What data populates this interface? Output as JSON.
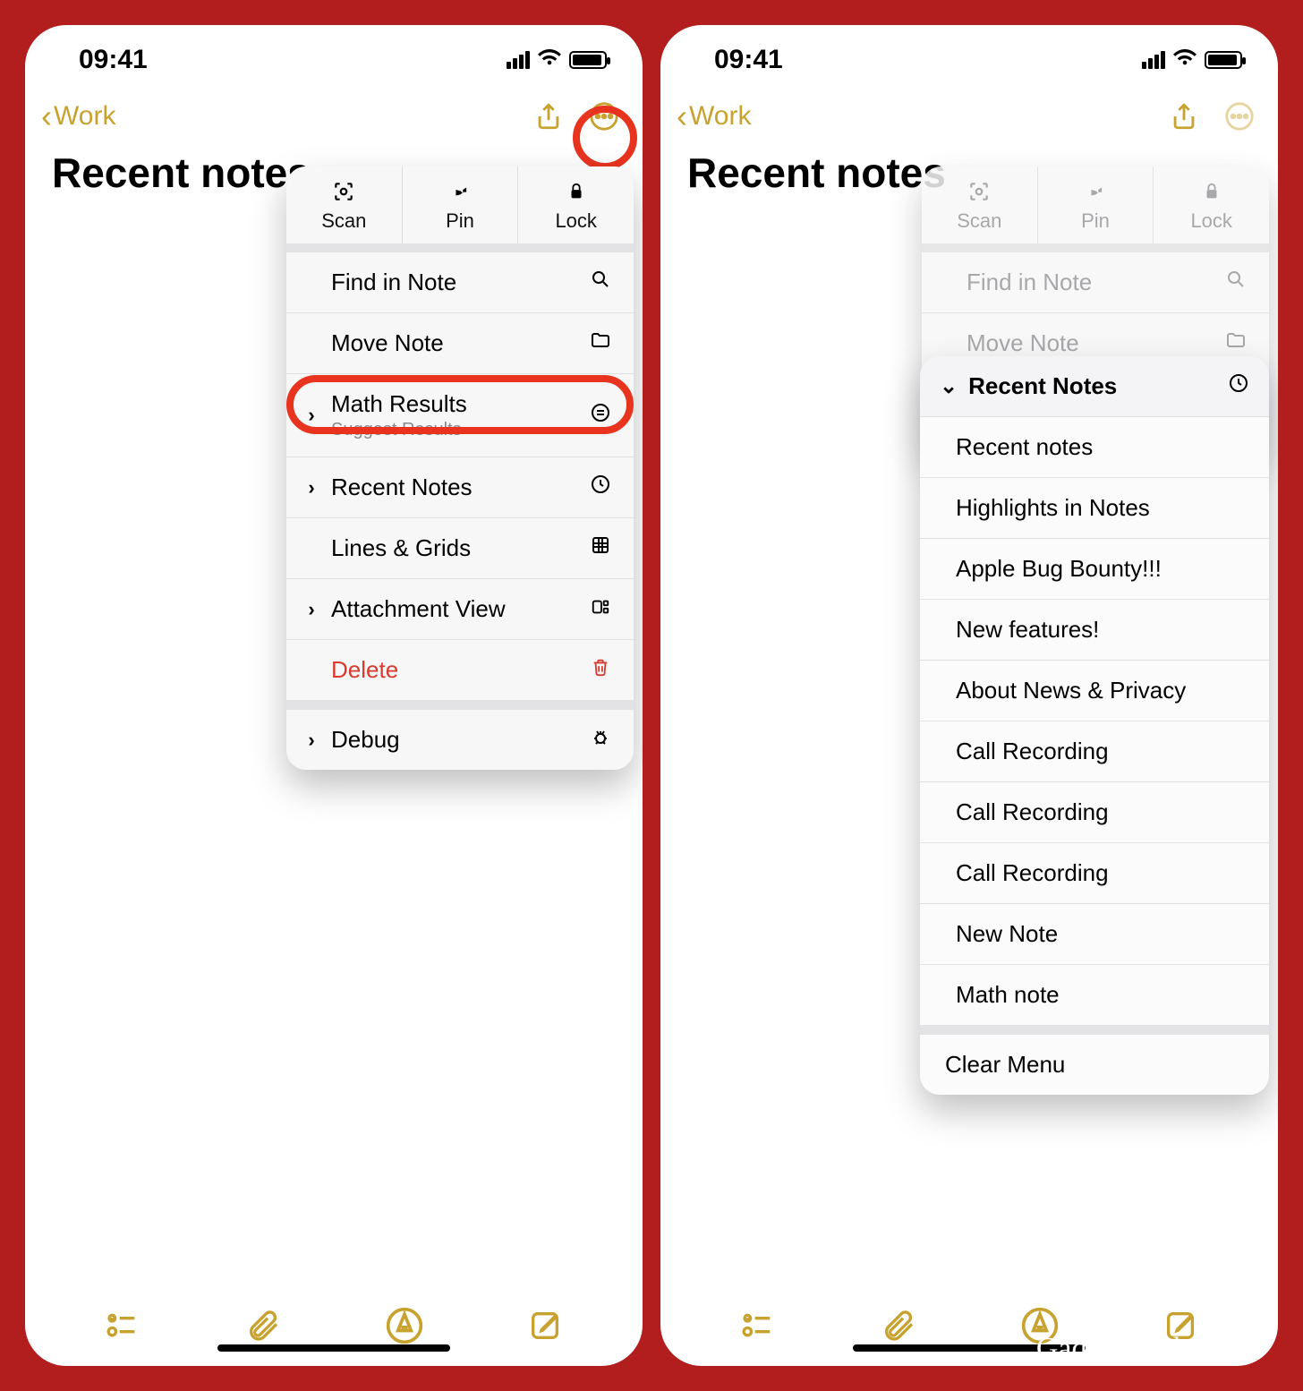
{
  "status": {
    "time": "09:41"
  },
  "nav": {
    "back_label": "Work"
  },
  "page": {
    "title": "Recent notes"
  },
  "popup_top": {
    "scan": "Scan",
    "pin": "Pin",
    "lock": "Lock"
  },
  "menu": {
    "find": "Find in Note",
    "move": "Move Note",
    "math": "Math Results",
    "math_sub": "Suggest Results",
    "recent": "Recent Notes",
    "lines": "Lines & Grids",
    "attach": "Attachment View",
    "delete": "Delete",
    "debug": "Debug"
  },
  "submenu": {
    "header": "Recent Notes",
    "items": [
      "Recent notes",
      "Highlights in Notes",
      "Apple Bug Bounty!!!",
      "New features!",
      "About News & Privacy",
      "Call Recording",
      "Call Recording",
      "Call Recording",
      "New Note",
      "Math note"
    ],
    "clear": "Clear Menu"
  },
  "credit": "GadgetHacks.com"
}
